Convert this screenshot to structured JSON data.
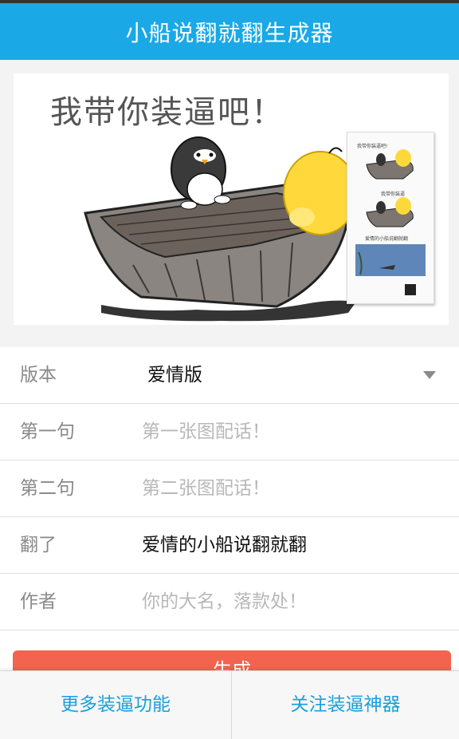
{
  "header": {
    "title": "小船说翻就翻生成器"
  },
  "preview": {
    "title": "我带你装逼吧！",
    "mini_caption_1": "我带你装逼吧!",
    "mini_caption_2": "我带你装逼",
    "mini_caption_3": "爱情的小船说翻就翻"
  },
  "form": {
    "version": {
      "label": "版本",
      "value": "爱情版"
    },
    "line1": {
      "label": "第一句",
      "value": "",
      "placeholder": "第一张图配话！"
    },
    "line2": {
      "label": "第二句",
      "value": "",
      "placeholder": "第二张图配话！"
    },
    "flipped": {
      "label": "翻了",
      "value": "爱情的小船说翻就翻",
      "placeholder": ""
    },
    "author": {
      "label": "作者",
      "value": "",
      "placeholder": "你的大名，落款处！"
    }
  },
  "submit": {
    "label": "生成"
  },
  "bottom": {
    "more_label": "更多装逼功能",
    "follow_label": "关注装逼神器"
  },
  "colors": {
    "header_bg": "#1aa8e6",
    "submit_bg": "#f2644f",
    "link_text": "#1a9fdb"
  }
}
